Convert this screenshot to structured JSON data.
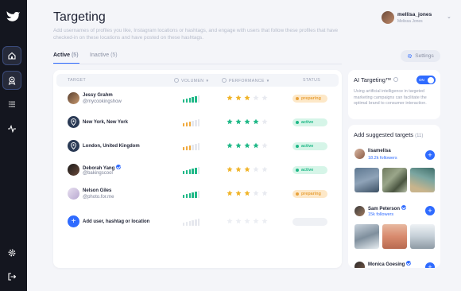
{
  "app": {
    "title": "Targeting",
    "description": "Add usernames of profiles you like, Instagram locations or hashtags, and engage with users that follow these profiles that have checked-in on these locations and have posted on these hashtags."
  },
  "user": {
    "name": "mellisa_jones",
    "full_name": "Melissa Jones"
  },
  "tabs": [
    {
      "label": "Active",
      "count": "(5)"
    },
    {
      "label": "Inactive",
      "count": "(5)"
    }
  ],
  "settings_label": "Settings",
  "table": {
    "headers": {
      "target": "TARGET",
      "volume": "VOLUMEN",
      "performance": "PERFORMANCE",
      "status": "STATUS"
    },
    "rows": [
      {
        "name": "Jessy Grahm",
        "handle": "@mycookingshow",
        "verified": false,
        "volume": 5,
        "volume_color": "#1fb887",
        "stars": 3,
        "star_color": "#f0b429",
        "status": "preparing"
      },
      {
        "name": "New York, New York",
        "handle": "",
        "verified": false,
        "volume": 3,
        "volume_color": "#f0a93c",
        "stars": 4,
        "star_color": "#1fb887",
        "status": "active"
      },
      {
        "name": "London, United Kingdom",
        "handle": "",
        "verified": false,
        "volume": 3,
        "volume_color": "#f0a93c",
        "stars": 4,
        "star_color": "#1fb887",
        "status": "active"
      },
      {
        "name": "Deborah Yang",
        "handle": "@bakingscool",
        "verified": true,
        "volume": 5,
        "volume_color": "#1fb887",
        "stars": 3,
        "star_color": "#f0b429",
        "status": "active"
      },
      {
        "name": "Nelson Giles",
        "handle": "@photo.for.me",
        "verified": false,
        "volume": 5,
        "volume_color": "#1fb887",
        "stars": 3,
        "star_color": "#f0b429",
        "status": "preparing"
      }
    ],
    "add_label": "Add user, hashtag or location"
  },
  "ai_targeting": {
    "title": "AI Targeting™",
    "toggle_label": "ON",
    "description": "Using artificial intelligence in targeted marketing campaigns can facilitate the optimal brand to consumer interaction."
  },
  "suggested": {
    "title": "Add suggested targets",
    "count": "(11)",
    "items": [
      {
        "name": "lisamelisa",
        "followers": "18.2k followers",
        "verified": false
      },
      {
        "name": "Sam Peterson",
        "followers": "15k followers",
        "verified": true
      },
      {
        "name": "Monica Goesing",
        "followers": "",
        "verified": true
      }
    ]
  },
  "colors": {
    "accent": "#2f6bff",
    "active": "#1fb887",
    "preparing": "#e8a23c",
    "sidebar": "#14161f"
  },
  "icons": [
    "bird-logo-icon",
    "home-icon",
    "target-icon",
    "list-icon",
    "activity-icon",
    "gear-icon",
    "logout-icon",
    "info-icon",
    "sort-arrow-icon",
    "verified-icon",
    "plus-icon",
    "chevron-down-icon"
  ]
}
